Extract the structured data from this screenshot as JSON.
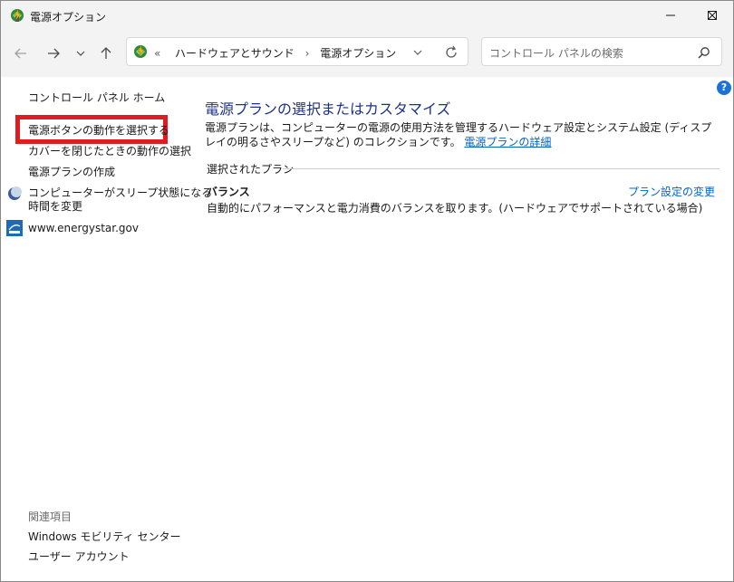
{
  "window": {
    "title": "電源オプション"
  },
  "navigation": {
    "breadcrumb_prefix": "«",
    "breadcrumb": [
      "ハードウェアとサウンド",
      "電源オプション"
    ],
    "breadcrumb_separator": "›",
    "search_placeholder": "コントロール パネルの検索"
  },
  "sidebar": {
    "home": "コントロール パネル ホーム",
    "items": [
      "電源ボタンの動作を選択する",
      "カバーを閉じたときの動作の選択",
      "電源プランの作成",
      "コンピューターがスリープ状態になる",
      "時間を変更",
      "www.energystar.gov"
    ],
    "highlighted_item_color": "#e11b22",
    "related_heading": "関連項目",
    "related": [
      "Windows モビリティ センター",
      "ユーザー アカウント"
    ]
  },
  "main": {
    "title": "電源プランの選択またはカスタマイズ",
    "description": "電源プランは、コンピューターの電源の使用方法を管理するハードウェア設定とシステム設定 (ディスプレイの明るさやスリープなど) のコレクションです。",
    "details_link": "電源プランの詳細",
    "selected_plan_label": "選択されたプラン",
    "plan": {
      "name": "バランス",
      "description": "自動的にパフォーマンスと電力消費のバランスを取ります。(ハードウェアでサポートされている場合)",
      "settings_link": "プラン設定の変更"
    },
    "help_glyph": "?"
  },
  "colors": {
    "title_blue": "#1e3287",
    "link_blue": "#0066cc",
    "chrome_bg": "#f3f3f3"
  }
}
